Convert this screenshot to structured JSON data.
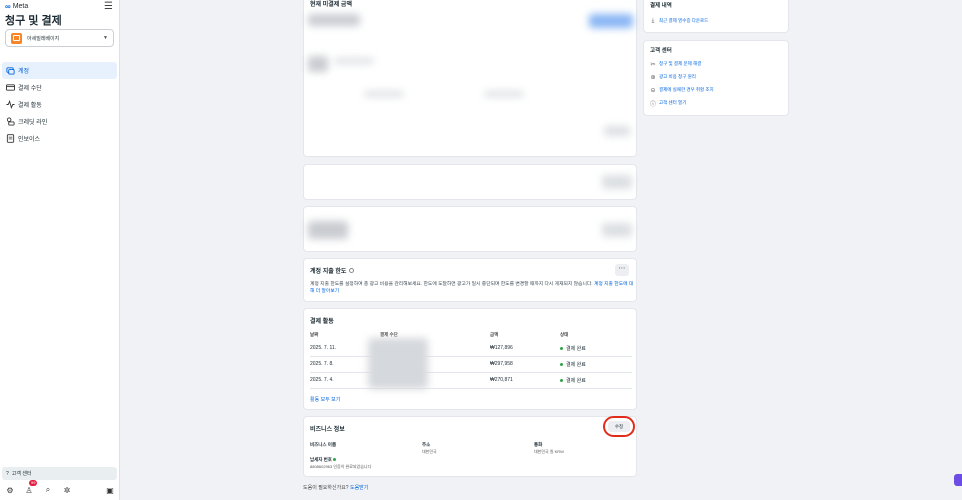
{
  "sidebar": {
    "brand": "Meta",
    "title": "청구 및 결제",
    "account": "아세밀레베이지",
    "nav": [
      {
        "label": "계정",
        "icon": "accounts-icon",
        "active": true
      },
      {
        "label": "결제 수단",
        "icon": "credit-card-icon",
        "active": false
      },
      {
        "label": "결제 활동",
        "icon": "activity-icon",
        "active": false
      },
      {
        "label": "크레딧 라인",
        "icon": "credit-line-icon",
        "active": false
      },
      {
        "label": "인보이스",
        "icon": "invoice-icon",
        "active": false
      }
    ],
    "help": "고객 센터",
    "notification_count": "99"
  },
  "unpaid": {
    "title": "현재 미결제 금액"
  },
  "spending_limit": {
    "title": "계정 지출 한도",
    "description": "계정 지출 한도를 설정하여 총 광고 비용을 관리해보세요. 한도에 도달하면 광고가 일시 중단되며 한도를 변경할 때까지 다시 게재되지 않습니다.",
    "link": "계정 지출 한도에 대해 더 알아보기"
  },
  "payment_activity": {
    "title": "결제 활동",
    "columns": [
      "날짜",
      "결제 수단",
      "금액",
      "상태"
    ],
    "rows": [
      {
        "date": "2025. 7. 11.",
        "amount": "₩127,896",
        "status": "결제 완료"
      },
      {
        "date": "2025. 7. 8.",
        "amount": "₩297,958",
        "status": "결제 완료"
      },
      {
        "date": "2025. 7. 4.",
        "amount": "₩270,871",
        "status": "결제 완료"
      }
    ],
    "see_all": "활동 모두 보기"
  },
  "business_info": {
    "title": "비즈니스 정보",
    "edit": "수정",
    "name_label": "비즈니스 이름",
    "address_label": "주소",
    "address_value": "대한민국",
    "currency_label": "통화",
    "currency_value": "대한민국 원 KRW",
    "tax_label": "납세자 번호",
    "tax_value": "8808602963 인증이 완료되었습니다"
  },
  "help_footer": {
    "text": "도움이 필요하신가요?",
    "link": "도움받기"
  },
  "payment_history": {
    "title": "결제 내역",
    "link": "최근 결제 영수증 다운로드"
  },
  "customer_center": {
    "title": "고객 센터",
    "links": [
      {
        "label": "청구 및 결제 문제 해결",
        "icon": "wrench-icon"
      },
      {
        "label": "광고 비용 청구 원리",
        "icon": "coin-icon"
      },
      {
        "label": "결제에 실패한 경우 취할 조치",
        "icon": "warning-icon"
      },
      {
        "label": "고객 센터 열기",
        "icon": "help-icon"
      }
    ]
  },
  "colors": {
    "accent": "#0064e0",
    "success": "#31a24c",
    "highlight_ring": "#e22c1b"
  }
}
